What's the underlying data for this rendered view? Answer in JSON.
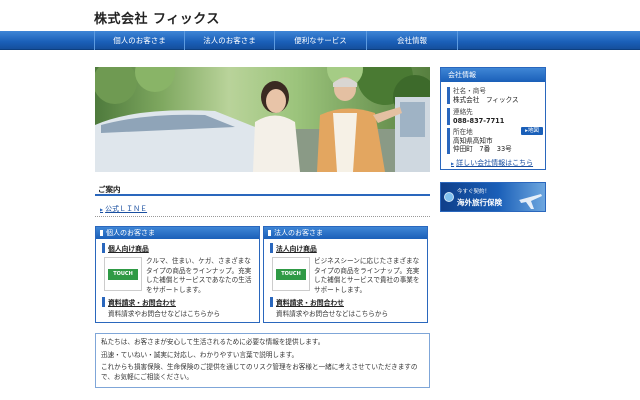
{
  "site": {
    "title": "株式会社 フィックス"
  },
  "nav": {
    "items": [
      {
        "label": "個人のお客さま"
      },
      {
        "label": "法人のお客さま"
      },
      {
        "label": "便利なサービス"
      },
      {
        "label": "会社情報"
      }
    ]
  },
  "guide": {
    "heading": "ご案内",
    "line_link": "公式ＬＩＮＥ"
  },
  "personal": {
    "heading": "個人のお客さま",
    "products_label": "個人向け商品",
    "logo_text": "TOUCH",
    "description": "クルマ、住まい、ケガ、さまざまなタイプの商品をラインナップ。充実した補償とサービスであなたの生活をサポートします。",
    "contact_label": "資料請求・お問合わせ",
    "contact_note": "資料請求やお問合せなどはこちらから"
  },
  "corporate": {
    "heading": "法人のお客さま",
    "products_label": "法人向け商品",
    "logo_text": "TOUCH",
    "description": "ビジネスシーンに応じたさまざまなタイプの商品をラインナップ。充実した補償とサービスで貴社の事業をサポートします。",
    "contact_label": "資料請求・お問合わせ",
    "contact_note": "資料請求やお問合せなどはこちらから"
  },
  "about": {
    "line1": "私たちは、お客さまが安心して生活されるために必要な情報を提供します。",
    "line2": "迅速・ていねい・誠実に対応し、わかりやすい言葉で説明します。",
    "line3": "これからも損害保険、生命保険のご提供を通じてのリスク管理をお客様と一緒に考えさせていただきますので、お気軽にご相談ください。"
  },
  "company": {
    "heading": "会社情報",
    "name_label": "社名・商号",
    "name_value": "株式会社　フィックス",
    "contact_label": "連絡先",
    "phone": "088-837-7711",
    "address_label": "所在地",
    "address_line1": "高知県高知市",
    "address_line2": "仲田町　7番　33号",
    "map_button": "地図",
    "details_link": "詳しい会社情報はこちら"
  },
  "banner": {
    "small_text": "今すぐ契約！",
    "big_text": "海外旅行保険"
  },
  "colors": {
    "accent": "#1a5fb8",
    "nav_gradient_top": "#3f86d6",
    "logo_green": "#2f9a45"
  }
}
